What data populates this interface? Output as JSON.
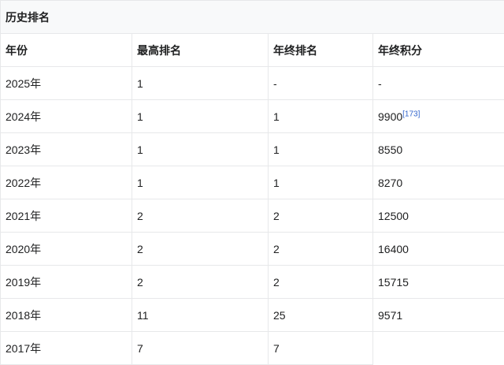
{
  "table": {
    "caption": "历史排名",
    "headers": [
      "年份",
      "最高排名",
      "年终排名",
      "年终积分"
    ],
    "rows": [
      {
        "year": "2025年",
        "peak": "1",
        "final": "-",
        "points": "-",
        "ref": ""
      },
      {
        "year": "2024年",
        "peak": "1",
        "final": "1",
        "points": "9900",
        "ref": "[173]"
      },
      {
        "year": "2023年",
        "peak": "1",
        "final": "1",
        "points": "8550",
        "ref": ""
      },
      {
        "year": "2022年",
        "peak": "1",
        "final": "1",
        "points": "8270",
        "ref": ""
      },
      {
        "year": "2021年",
        "peak": "2",
        "final": "2",
        "points": "12500",
        "ref": ""
      },
      {
        "year": "2020年",
        "peak": "2",
        "final": "2",
        "points": "16400",
        "ref": ""
      },
      {
        "year": "2019年",
        "peak": "2",
        "final": "2",
        "points": "15715",
        "ref": ""
      },
      {
        "year": "2018年",
        "peak": "11",
        "final": "25",
        "points": "9571",
        "ref": ""
      },
      {
        "year": "2017年",
        "peak": "7",
        "final": "7",
        "points": "",
        "ref": ""
      }
    ]
  },
  "colors": {
    "border": "#e7e8ea",
    "caption_bg": "#f8f9fa",
    "link": "#3366cc",
    "text": "#202122"
  }
}
